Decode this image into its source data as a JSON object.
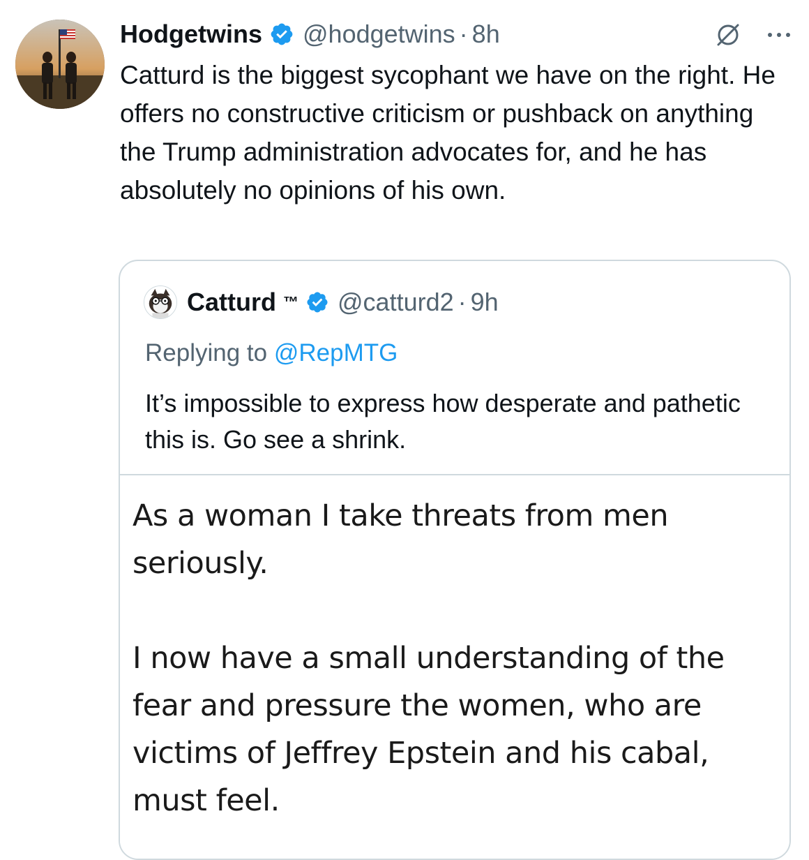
{
  "tweet": {
    "author": {
      "display_name": "Hodgetwins",
      "handle": "@hodgetwins",
      "verified": true
    },
    "separator": "·",
    "time": "8h",
    "text": "Catturd is the biggest sycophant we have on the right. He offers no constructive criticism or pushback on anything the Trump administration advocates for, and he has absolutely no opinions of his own.",
    "icons": {
      "grok": "grok-icon",
      "more": "more-icon"
    }
  },
  "quote": {
    "author": {
      "display_name": "Catturd",
      "tm": "™",
      "handle": "@catturd2",
      "verified": true
    },
    "separator": "·",
    "time": "9h",
    "replying_prefix": "Replying to ",
    "replying_to": "@RepMTG",
    "text": "It’s impossible to express how desperate and pathetic this is. Go see a shrink.",
    "media": {
      "paragraph_1": "As a woman I take threats from men seriously.",
      "paragraph_2": "I now have a small understanding of the fear and pressure the women, who are victims of Jeffrey Epstein and his cabal, must feel."
    }
  },
  "colors": {
    "text_primary": "#0f1419",
    "text_secondary": "#536471",
    "link": "#1d9bf0",
    "verified": "#1d9bf0",
    "border": "#cfd9de"
  }
}
